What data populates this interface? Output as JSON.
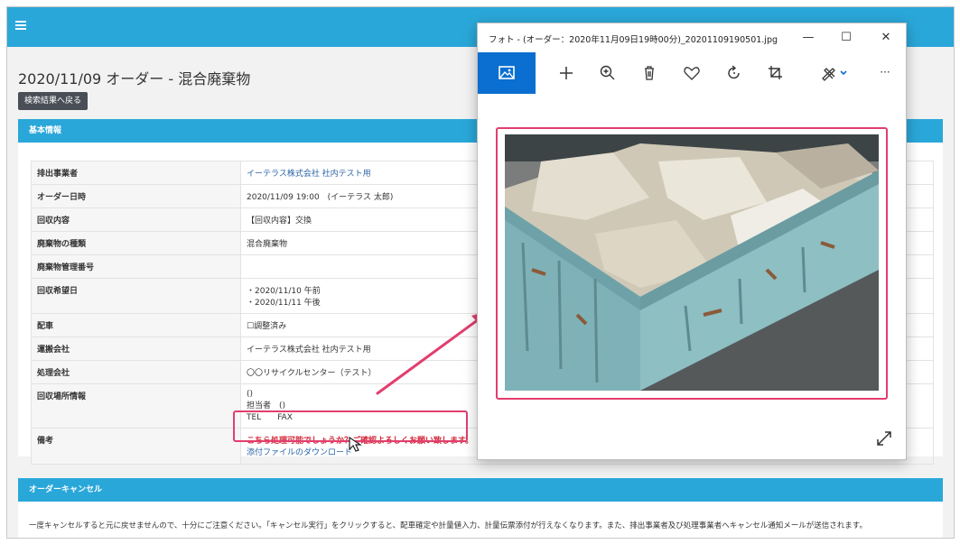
{
  "page": {
    "title": "2020/11/09 オーダー - 混合廃棄物",
    "back_button": "検索結果へ戻る"
  },
  "basic_info": {
    "heading": "基本情報",
    "rows": [
      {
        "label": "排出事業者",
        "value": "イーテラス株式会社 社内テスト用"
      },
      {
        "label": "オーダー日時",
        "value": "2020/11/09 19:00　(イーテラス 太郎)"
      },
      {
        "label": "回収内容",
        "value": "【回収内容】交換"
      },
      {
        "label": "廃棄物の種類",
        "value": "混合廃棄物"
      },
      {
        "label": "廃棄物管理番号",
        "value": ""
      },
      {
        "label": "回収希望日",
        "line1": "・2020/11/10 午前",
        "line2": "・2020/11/11 午後"
      },
      {
        "label": "配車",
        "value": "☐調整済み"
      },
      {
        "label": "運搬会社",
        "value": "イーテラス株式会社 社内テスト用"
      },
      {
        "label": "処理会社",
        "value": "〇〇リサイクルセンター（テスト）"
      },
      {
        "label": "回収場所情報",
        "line1": "()",
        "line2": "担当者　()",
        "line3": "TEL　　FAX"
      },
      {
        "label": "備考",
        "line1": "こちら処理可能でしょうか？ご確認よろしくお願い致します。",
        "line2": "添付ファイルのダウンロード"
      }
    ]
  },
  "cancel": {
    "heading": "オーダーキャンセル",
    "text": "一度キャンセルすると元に戻せませんので、十分にご注意ください。「キャンセル実行」をクリックすると、配車確定や計量値入力、計量伝票添付が行えなくなります。また、排出事業者及び処理事業者へキャンセル通知メールが送信されます。"
  },
  "viewer": {
    "title": "フォト - (オーダー：2020年11月09日19時00分)_20201109190501.jpg",
    "minimize": "—",
    "maximize": "☐",
    "close": "✕",
    "more": "···"
  },
  "colors": {
    "header_blue": "#2aa7d9",
    "highlight_pink": "#e23e6e",
    "accent_blue": "#0a6fd0"
  }
}
